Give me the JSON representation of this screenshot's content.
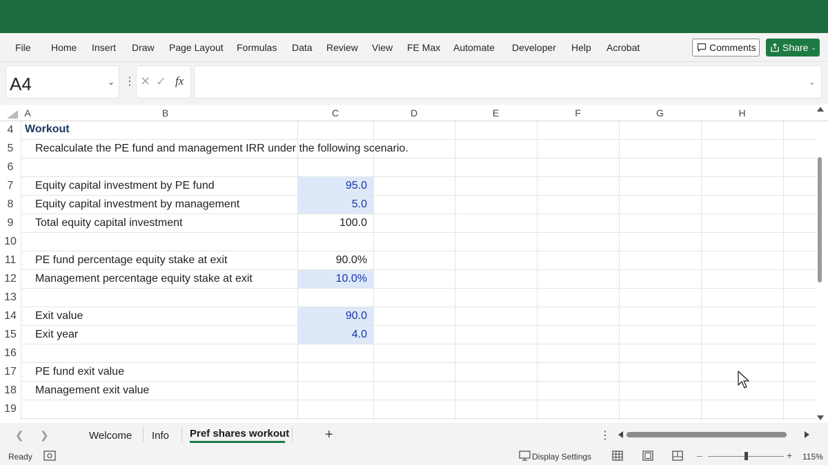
{
  "ribbon": {
    "menu": [
      "File",
      "Home",
      "Insert",
      "Draw",
      "Page Layout",
      "Formulas",
      "Data",
      "Review",
      "View",
      "FE Max",
      "Automate",
      "Developer",
      "Help",
      "Acrobat"
    ],
    "comments_label": "Comments",
    "share_label": "Share"
  },
  "formula_bar": {
    "name_box": "A4",
    "formula": ""
  },
  "columns": [
    "A",
    "B",
    "C",
    "D",
    "E",
    "F",
    "G",
    "H"
  ],
  "rows": [
    {
      "num": "4",
      "a": "Workout",
      "b": "",
      "c": "",
      "c_input": false
    },
    {
      "num": "5",
      "a": "",
      "b": "Recalculate the PE fund and management IRR under the following scenario.",
      "c": "",
      "c_input": false
    },
    {
      "num": "6",
      "a": "",
      "b": "",
      "c": "",
      "c_input": false
    },
    {
      "num": "7",
      "a": "",
      "b": "Equity capital investment by PE fund",
      "c": "95.0",
      "c_input": true
    },
    {
      "num": "8",
      "a": "",
      "b": "Equity capital investment by management",
      "c": "5.0",
      "c_input": true
    },
    {
      "num": "9",
      "a": "",
      "b": "Total equity capital investment",
      "c": "100.0",
      "c_input": false
    },
    {
      "num": "10",
      "a": "",
      "b": "",
      "c": "",
      "c_input": false
    },
    {
      "num": "11",
      "a": "",
      "b": "PE fund percentage equity stake at exit",
      "c": "90.0%",
      "c_input": false
    },
    {
      "num": "12",
      "a": "",
      "b": "Management percentage equity stake at exit",
      "c": "10.0%",
      "c_input": true
    },
    {
      "num": "13",
      "a": "",
      "b": "",
      "c": "",
      "c_input": false
    },
    {
      "num": "14",
      "a": "",
      "b": "Exit value",
      "c": "90.0",
      "c_input": true
    },
    {
      "num": "15",
      "a": "",
      "b": "Exit year",
      "c": "4.0",
      "c_input": true
    },
    {
      "num": "16",
      "a": "",
      "b": "",
      "c": "",
      "c_input": false
    },
    {
      "num": "17",
      "a": "",
      "b": "PE fund exit value",
      "c": "",
      "c_input": false
    },
    {
      "num": "18",
      "a": "",
      "b": "Management exit value",
      "c": "",
      "c_input": false
    },
    {
      "num": "19",
      "a": "",
      "b": "",
      "c": "",
      "c_input": false
    }
  ],
  "sheets": {
    "tabs": [
      "Welcome",
      "Info",
      "Pref shares workout"
    ],
    "active": "Pref shares workout"
  },
  "status": {
    "ready": "Ready",
    "display_settings": "Display Settings",
    "zoom": "115%"
  },
  "colors": {
    "titlebar": "#1e6b3d",
    "accent": "#1e7a43",
    "input_fill": "#dde9f8",
    "input_text": "#1a34a8",
    "heading_text": "#1f3864"
  }
}
